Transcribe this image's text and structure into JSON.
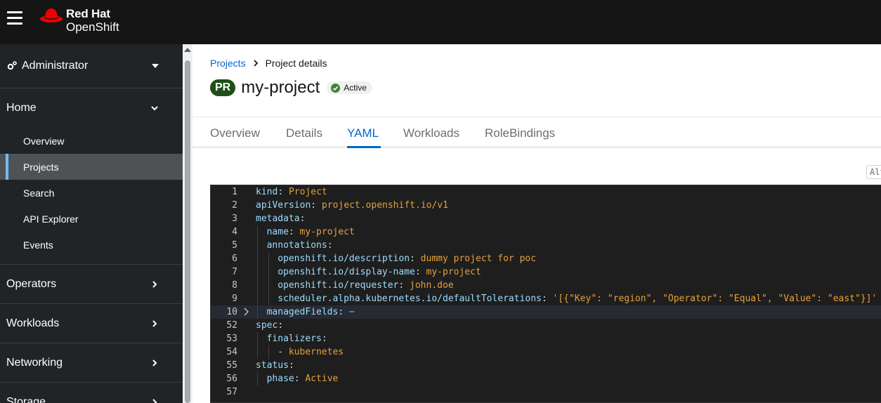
{
  "brand": {
    "line1": "Red Hat",
    "line2": "OpenShift"
  },
  "sidebar": {
    "perspective": "Administrator",
    "home": {
      "label": "Home",
      "items": [
        "Overview",
        "Projects",
        "Search",
        "API Explorer",
        "Events"
      ],
      "active": "Projects"
    },
    "sections": [
      "Operators",
      "Workloads",
      "Networking",
      "Storage"
    ]
  },
  "breadcrumb": {
    "parent": "Projects",
    "current": "Project details"
  },
  "header": {
    "badge": "PR",
    "name": "my-project",
    "status": "Active"
  },
  "tabs": [
    "Overview",
    "Details",
    "YAML",
    "Workloads",
    "RoleBindings"
  ],
  "active_tab": "YAML",
  "editor": {
    "shortcut_hint": "Alt",
    "lines": [
      {
        "n": "1",
        "indent": 0,
        "key": "kind",
        "value": "Project"
      },
      {
        "n": "2",
        "indent": 0,
        "key": "apiVersion",
        "value": "project.openshift.io/v1"
      },
      {
        "n": "3",
        "indent": 0,
        "key": "metadata",
        "value": ""
      },
      {
        "n": "4",
        "indent": 1,
        "key": "name",
        "value": "my-project"
      },
      {
        "n": "5",
        "indent": 1,
        "key": "annotations",
        "value": ""
      },
      {
        "n": "6",
        "indent": 2,
        "key": "openshift.io/description",
        "value": "dummy project for poc"
      },
      {
        "n": "7",
        "indent": 2,
        "key": "openshift.io/display-name",
        "value": "my-project"
      },
      {
        "n": "8",
        "indent": 2,
        "key": "openshift.io/requester",
        "value": "john.doe"
      },
      {
        "n": "9",
        "indent": 2,
        "key": "scheduler.alpha.kubernetes.io/defaultTolerations",
        "value": "'[{\"Key\": \"region\", \"Operator\": \"Equal\", \"Value\": \"east\"}]'"
      },
      {
        "n": "10",
        "indent": 1,
        "key": "managedFields",
        "value": "",
        "folded": true
      },
      {
        "n": "52",
        "indent": 0,
        "key": "spec",
        "value": ""
      },
      {
        "n": "53",
        "indent": 1,
        "key": "finalizers",
        "value": ""
      },
      {
        "n": "54",
        "indent": 2,
        "key": "",
        "value": "kubernetes",
        "dash": true
      },
      {
        "n": "55",
        "indent": 0,
        "key": "status",
        "value": ""
      },
      {
        "n": "56",
        "indent": 1,
        "key": "phase",
        "value": "Active"
      },
      {
        "n": "57",
        "indent": 0,
        "key": "",
        "value": ""
      }
    ]
  },
  "colors": {
    "masthead": "#151515",
    "sidebar": "#212427",
    "link": "#0066cc",
    "badge": "#1e4f18",
    "yaml_key": "#9cdcfe",
    "yaml_value": "#e7a03b"
  }
}
